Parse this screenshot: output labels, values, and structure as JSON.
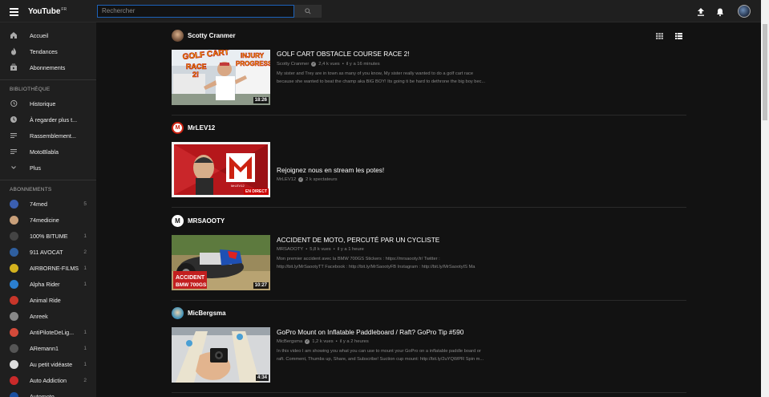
{
  "header": {
    "logo_you": "You",
    "logo_tube": "Tube",
    "logo_country": "FR",
    "search_placeholder": "Rechercher"
  },
  "sidebar": {
    "main": [
      {
        "label": "Accueil",
        "icon": "home-icon"
      },
      {
        "label": "Tendances",
        "icon": "flame-icon"
      },
      {
        "label": "Abonnements",
        "icon": "subscriptions-icon"
      }
    ],
    "library_heading": "BIBLIOTHÈQUE",
    "library": [
      {
        "label": "Historique",
        "icon": "history-icon"
      },
      {
        "label": "À regarder plus t...",
        "icon": "clock-icon"
      },
      {
        "label": "Rassemblement...",
        "icon": "playlist-icon"
      },
      {
        "label": "MotoBlabla",
        "icon": "playlist-icon"
      },
      {
        "label": "Plus",
        "icon": "chevron-down-icon"
      }
    ],
    "subs_heading": "ABONNEMENTS",
    "subs": [
      {
        "label": "74med",
        "count": "5",
        "color": "#3b5fb0"
      },
      {
        "label": "74medicine",
        "count": "",
        "color": "#c9a07a"
      },
      {
        "label": "100% BITUME",
        "count": "1",
        "color": "#444444"
      },
      {
        "label": "911 AVOCAT",
        "count": "2",
        "color": "#2f5f9f"
      },
      {
        "label": "AIRBORNE-FILMS",
        "count": "1",
        "color": "#d4b21e"
      },
      {
        "label": "Alpha Rider",
        "count": "1",
        "color": "#2b7fd0"
      },
      {
        "label": "Animal Ride",
        "count": "",
        "color": "#c8362a"
      },
      {
        "label": "Anreek",
        "count": "",
        "color": "#888888"
      },
      {
        "label": "AntiPiloteDeLig...",
        "count": "1",
        "color": "#d34a3a"
      },
      {
        "label": "ARemann1",
        "count": "1",
        "color": "#555555"
      },
      {
        "label": "Au petit vidéaste",
        "count": "1",
        "color": "#dddddd"
      },
      {
        "label": "Auto Addiction",
        "count": "2",
        "color": "#c92a2a"
      },
      {
        "label": "Automoto",
        "count": "",
        "color": "#1a4fa0"
      }
    ]
  },
  "feed": [
    {
      "channel": "Scotty Cranmer",
      "title": "GOLF CART OBSTACLE COURSE RACE 2!",
      "meta_channel": "Scotty Cranmer",
      "verified": true,
      "views": "2,4 k vues",
      "age": "il y a 16 minutes",
      "desc_1": "My sister and Trey are in town as many of you know, My sister really wanted to do a golf cart race",
      "desc_2": "because she wanted to beat the champ aka BIG BOY! Its going ti be hard to dethrone the big boy bec...",
      "duration": "18:26",
      "thumb_text_1": "GOLF CART",
      "thumb_text_2": "RACE",
      "thumb_text_3": "2!",
      "thumb_text_4": "INJURY",
      "thumb_text_5": "PROGRESS!"
    },
    {
      "channel": "MrLEV12",
      "title": "Rejoignez nous en stream les potes!",
      "meta_channel": "MrLEV12",
      "verified": true,
      "views": "2 k spectateurs",
      "age": "",
      "desc_1": "",
      "desc_2": "",
      "duration": "",
      "live_badge": "EN DIRECT",
      "logo_text": "MrLEV12"
    },
    {
      "channel": "MRSAOOTY",
      "title": "ACCIDENT DE MOTO, PERCUTÉ PAR UN CYCLISTE",
      "meta_channel": "MRSAOOTY",
      "verified": false,
      "views": "5,8 k vues",
      "age": "il y a 1 heure",
      "desc_1": "Mon premier accident avec la BMW 700GS Stickers : https://mrsaooty.fr/ Twitter :",
      "desc_2": "http://bit.ly/MrSaootyTT Facebook : http://bit.ly/MrSaootyFB Instagram : http://bit.ly/MrSaootyIS Ma",
      "duration": "10:27",
      "thumb_text_1": "ACCIDENT",
      "thumb_text_2": "BMW 700GS"
    },
    {
      "channel": "MicBergsma",
      "title": "GoPro Mount on Inflatable Paddleboard / Raft? GoPro Tip #590",
      "meta_channel": "MicBergsma",
      "verified": true,
      "views": "1,2 k vues",
      "age": "il y a 2 heures",
      "desc_1": "In this video I am showing you what you can use to mount your GoPro on a inflatable paddle board or",
      "desc_2": "raft. Comment, Thumbs up, Share, and Subscribe! Suction cup mount: http://bit.ly/2uYQWPR Spin m...",
      "duration": "4:34"
    }
  ],
  "colors": {
    "background": "#121212",
    "surface": "#1f1f1f",
    "search_border": "#1c62b9"
  }
}
